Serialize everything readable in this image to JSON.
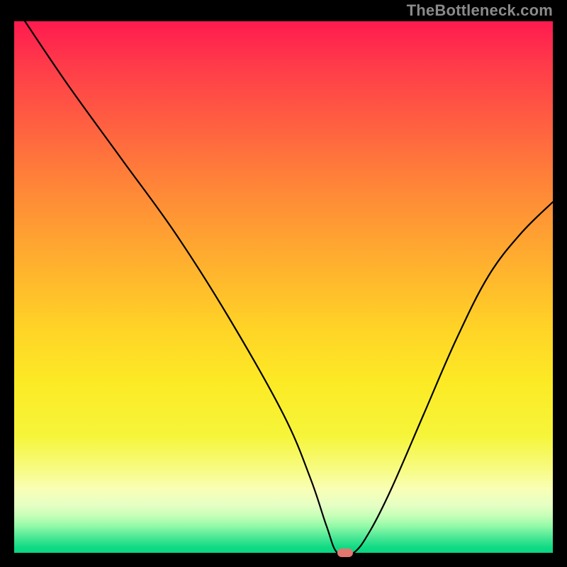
{
  "watermark": "TheBottleneck.com",
  "chart_data": {
    "type": "line",
    "title": "",
    "xlabel": "",
    "ylabel": "",
    "xlim": [
      0,
      100
    ],
    "ylim": [
      0,
      100
    ],
    "grid": false,
    "series": [
      {
        "name": "curve",
        "x": [
          2,
          10,
          20,
          30,
          40,
          50,
          55,
          58,
          60,
          63,
          66,
          70,
          76,
          82,
          88,
          94,
          100
        ],
        "y": [
          100,
          88,
          74,
          60,
          44,
          26,
          14,
          5,
          0,
          0,
          4,
          12,
          26,
          40,
          52,
          60,
          66
        ]
      }
    ],
    "marker": {
      "x": 61.5,
      "y": 0
    },
    "background_gradient": {
      "top": "#ff1a4f",
      "middle": "#ffd426",
      "bottom": "#0bd481"
    }
  }
}
